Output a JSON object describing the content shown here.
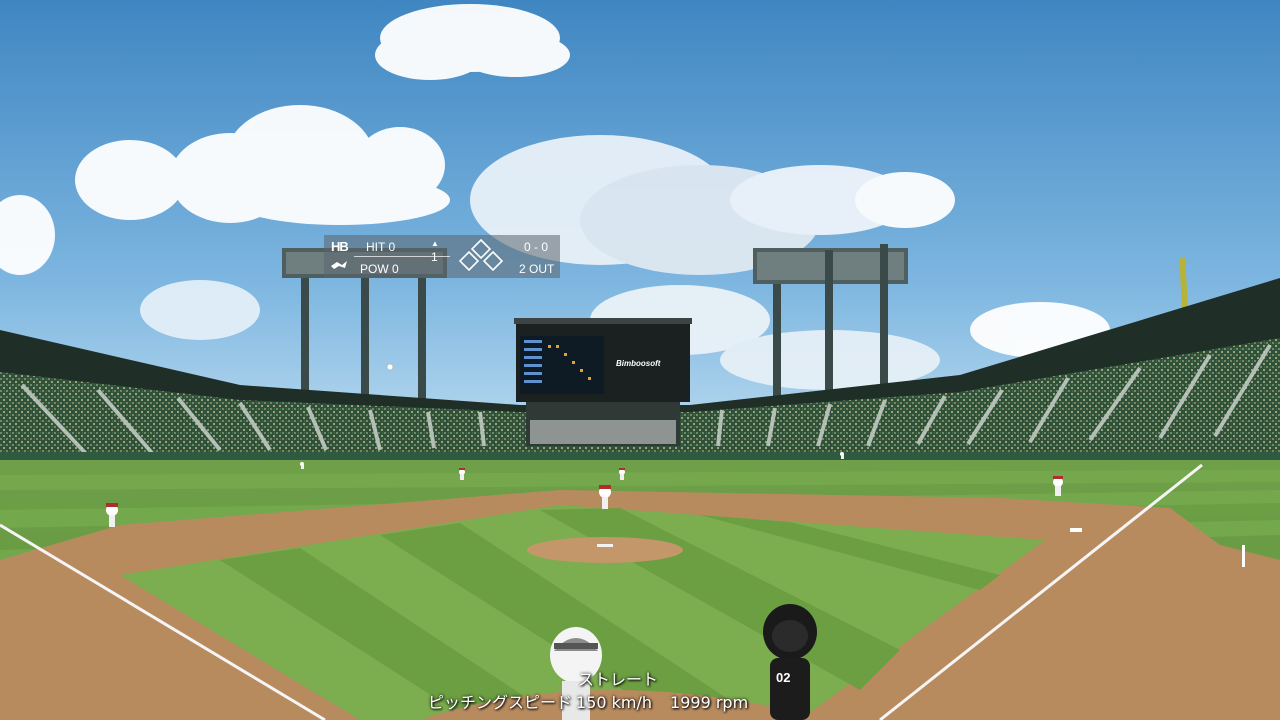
{
  "hud": {
    "team_logo": "HB",
    "hit_label": "HIT",
    "hit_value": "0",
    "pow_label": "POW",
    "pow_value": "0",
    "inning": "1",
    "inning_half": "top",
    "count": "0 - 0",
    "outs": "2 OUT",
    "bases_occupied": [
      false,
      false,
      false
    ]
  },
  "pitch": {
    "type": "ストレート",
    "speed_label": "ピッチングスピード",
    "speed": "150 km/h",
    "spin": "1999 rpm"
  },
  "scoreboard": {
    "brand": "Bimboosoft"
  },
  "batter": {
    "jersey_number": "02"
  },
  "colors": {
    "sky_top": "#4c8fc8",
    "sky_bottom": "#a9d3ec",
    "grass_light": "#7fb04e",
    "grass_dark": "#5e9338",
    "dirt": "#b98a5c",
    "stands": "#2f4a35"
  }
}
